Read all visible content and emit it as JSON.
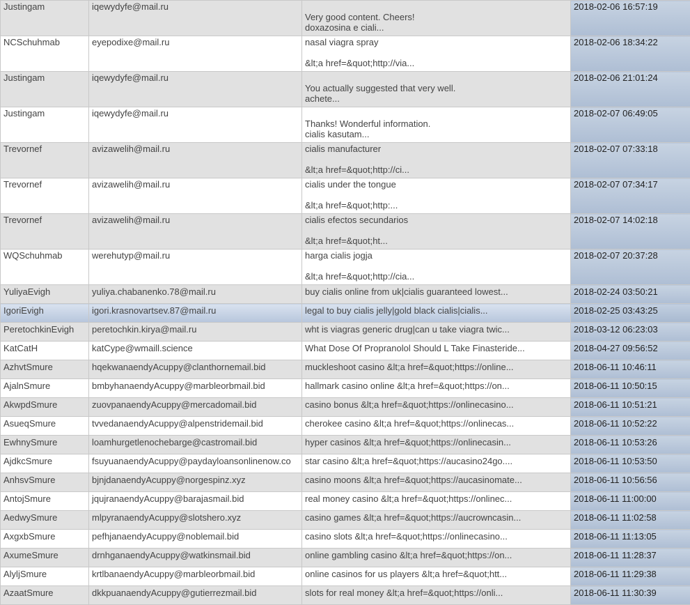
{
  "rows": [
    {
      "name": "Justingam",
      "email": "iqewydyfe@mail.ru",
      "msg": [
        "",
        "Very good content. Cheers!",
        "doxazosina e ciali..."
      ],
      "date": "2018-02-06 16:57:19"
    },
    {
      "name": "NCSchuhmab",
      "email": "eyepodixe@mail.ru",
      "msg": [
        "nasal viagra spray",
        "",
        "&lt;a href=&quot;http://via..."
      ],
      "date": "2018-02-06 18:34:22"
    },
    {
      "name": "Justingam",
      "email": "iqewydyfe@mail.ru",
      "msg": [
        "",
        "You actually suggested that very well.",
        "achete..."
      ],
      "date": "2018-02-06 21:01:24"
    },
    {
      "name": "Justingam",
      "email": "iqewydyfe@mail.ru",
      "msg": [
        "",
        "Thanks! Wonderful information.",
        "cialis kasutam..."
      ],
      "date": "2018-02-07 06:49:05"
    },
    {
      "name": "Trevornef",
      "email": "avizawelih@mail.ru",
      "msg": [
        "cialis manufacturer",
        "",
        "&lt;a href=&quot;http://ci..."
      ],
      "date": "2018-02-07 07:33:18"
    },
    {
      "name": "Trevornef",
      "email": "avizawelih@mail.ru",
      "msg": [
        "cialis under the tongue",
        "",
        "&lt;a href=&quot;http:..."
      ],
      "date": "2018-02-07 07:34:17"
    },
    {
      "name": "Trevornef",
      "email": "avizawelih@mail.ru",
      "msg": [
        "cialis efectos secundarios",
        "",
        "&lt;a href=&quot;ht..."
      ],
      "date": "2018-02-07 14:02:18"
    },
    {
      "name": "WQSchuhmab",
      "email": "werehutyp@mail.ru",
      "msg": [
        "harga cialis jogja",
        "",
        "&lt;a href=&quot;http://cia..."
      ],
      "date": "2018-02-07 20:37:28"
    },
    {
      "name": "YuliyaEvigh",
      "email": "yuliya.chabanenko.78@mail.ru",
      "msg": [
        "buy cialis online from uk|cialis guaranteed lowest..."
      ],
      "date": "2018-02-24 03:50:21"
    },
    {
      "name": "IgoriEvigh",
      "email": "igori.krasnovartsev.87@mail.ru",
      "msg": [
        "legal to buy cialis jelly|gold black cialis|cialis..."
      ],
      "date": "2018-02-25 03:43:25",
      "selected": true
    },
    {
      "name": "PeretochkinEvigh",
      "email": "peretochkin.kirya@mail.ru",
      "msg": [
        "wht is viagras generic drug|can u take viagra twic..."
      ],
      "date": "2018-03-12 06:23:03"
    },
    {
      "name": "KatCatH",
      "email": "katCype@wmaill.science",
      "msg": [
        "What Dose Of Propranolol Should L Take Finasteride..."
      ],
      "date": "2018-04-27 09:56:52"
    },
    {
      "name": "AzhvtSmure",
      "email": "hqekwanaendyAcuppy@clanthornemail.bid",
      "msg": [
        "muckleshoot casino &lt;a href=&quot;https://online..."
      ],
      "date": "2018-06-11 10:46:11"
    },
    {
      "name": "AjalnSmure",
      "email": "bmbyhanaendyAcuppy@marbleorbmail.bid",
      "msg": [
        "hallmark casino online &lt;a href=&quot;https://on..."
      ],
      "date": "2018-06-11 10:50:15"
    },
    {
      "name": "AkwpdSmure",
      "email": "zuovpanaendyAcuppy@mercadomail.bid",
      "msg": [
        "casino bonus &lt;a href=&quot;https://onlinecasino..."
      ],
      "date": "2018-06-11 10:51:21"
    },
    {
      "name": "AsueqSmure",
      "email": "tvvedanaendyAcuppy@alpenstridemail.bid",
      "msg": [
        "cherokee casino &lt;a href=&quot;https://onlinecas..."
      ],
      "date": "2018-06-11 10:52:22"
    },
    {
      "name": "EwhnySmure",
      "email": "loamhurgetlenochebarge@castromail.bid",
      "msg": [
        "hyper casinos &lt;a href=&quot;https://onlinecasin..."
      ],
      "date": "2018-06-11 10:53:26"
    },
    {
      "name": "AjdkcSmure",
      "email": "fsuyuanaendyAcuppy@paydayloansonlinenow.co",
      "msg": [
        "star casino &lt;a href=&quot;https://aucasino24go...."
      ],
      "date": "2018-06-11 10:53:50"
    },
    {
      "name": "AnhsvSmure",
      "email": "bjnjdanaendyAcuppy@norgespinz.xyz",
      "msg": [
        "casino moons &lt;a href=&quot;https://aucasinomate..."
      ],
      "date": "2018-06-11 10:56:56"
    },
    {
      "name": "AntojSmure",
      "email": "jqujranaendyAcuppy@barajasmail.bid",
      "msg": [
        "real money casino &lt;a href=&quot;https://onlinec..."
      ],
      "date": "2018-06-11 11:00:00"
    },
    {
      "name": "AedwySmure",
      "email": "mlpyranaendyAcuppy@slotshero.xyz",
      "msg": [
        "casino games &lt;a href=&quot;https://aucrowncasin..."
      ],
      "date": "2018-06-11 11:02:58"
    },
    {
      "name": "AxgxbSmure",
      "email": "pefhjanaendyAcuppy@noblemail.bid",
      "msg": [
        "casino slots &lt;a href=&quot;https://onlinecasino..."
      ],
      "date": "2018-06-11 11:13:05"
    },
    {
      "name": "AxumeSmure",
      "email": "drnhganaendyAcuppy@watkinsmail.bid",
      "msg": [
        "online gambling casino &lt;a href=&quot;https://on..."
      ],
      "date": "2018-06-11 11:28:37"
    },
    {
      "name": "AlyljSmure",
      "email": "krtlbanaendyAcuppy@marbleorbmail.bid",
      "msg": [
        "online casinos for us players &lt;a href=&quot;htt..."
      ],
      "date": "2018-06-11 11:29:38"
    },
    {
      "name": "AzaatSmure",
      "email": "dkkpuanaendyAcuppy@gutierrezmail.bid",
      "msg": [
        "slots for real money &lt;a href=&quot;https://onli..."
      ],
      "date": "2018-06-11 11:30:39"
    }
  ]
}
